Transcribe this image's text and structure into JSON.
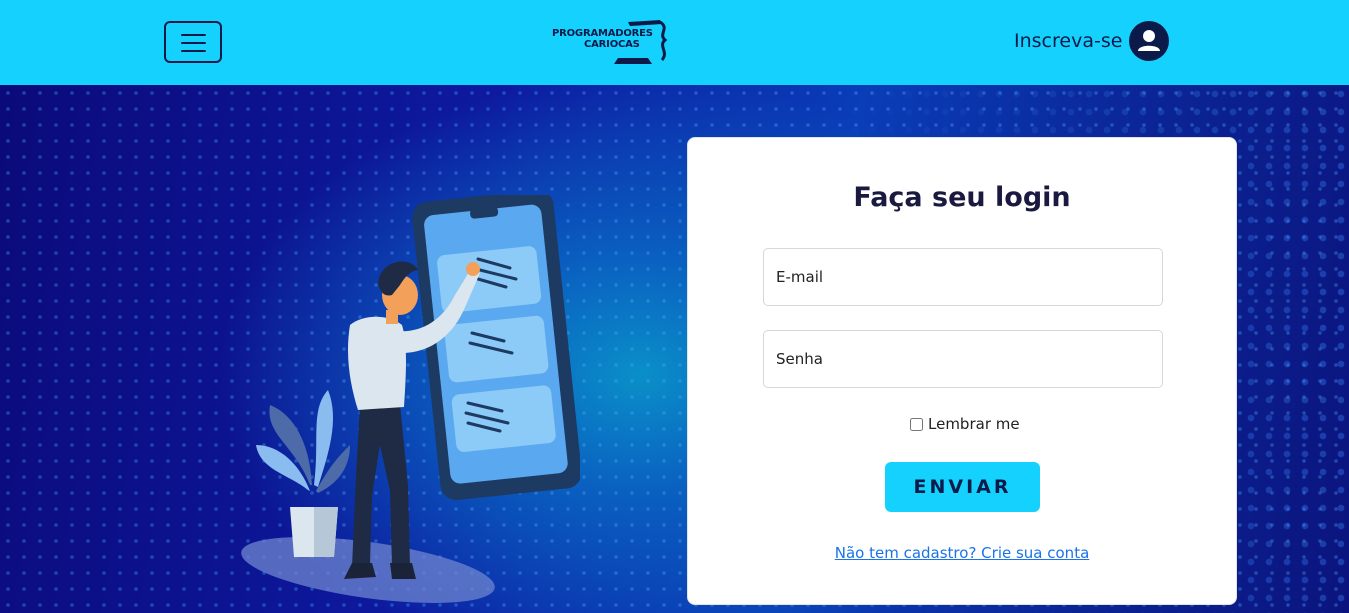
{
  "header": {
    "logo_line1": "PROGRAMADORES",
    "logo_line2": "CARIOCAS",
    "signup_label": "Inscreva-se",
    "menu_icon": "hamburger-icon",
    "avatar_icon": "user-icon",
    "colors": {
      "bar": "#14d2fd",
      "ink": "#0c1a4a"
    }
  },
  "login": {
    "title": "Faça seu login",
    "email_placeholder": "E-mail",
    "password_placeholder": "Senha",
    "remember_label": "Lembrar me",
    "submit_label": "ENVIAR",
    "register_link": "Não tem cadastro? Crie sua conta"
  }
}
